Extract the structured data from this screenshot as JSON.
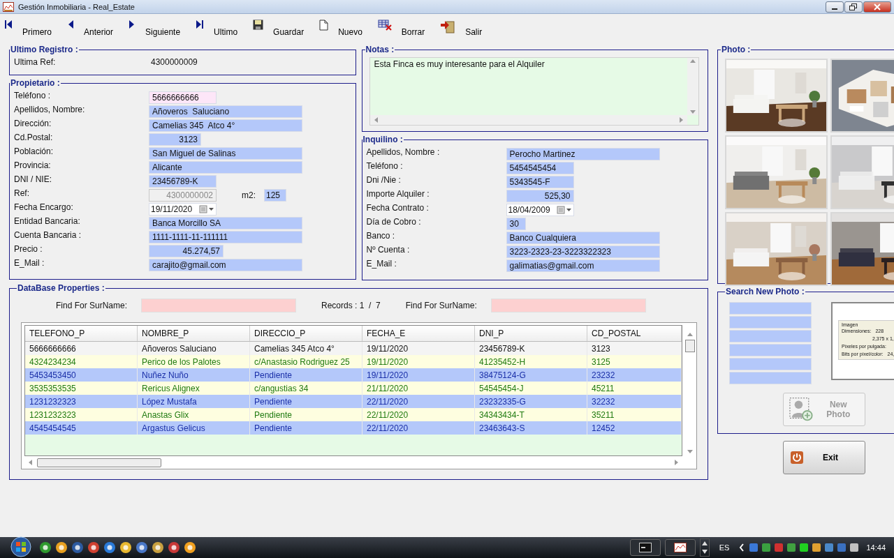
{
  "window": {
    "title": "Gestión Inmobiliaria - Real_Estate"
  },
  "toolbar": [
    {
      "label": "Primero",
      "kind": "first"
    },
    {
      "label": "Anterior",
      "kind": "prev"
    },
    {
      "label": "Siguiente",
      "kind": "next"
    },
    {
      "label": "Ultimo",
      "kind": "last"
    },
    {
      "label": "Guardar",
      "kind": "save"
    },
    {
      "label": "Nuevo",
      "kind": "new"
    },
    {
      "label": "Borrar",
      "kind": "delete"
    },
    {
      "label": "Salir",
      "kind": "exit"
    }
  ],
  "last_record": {
    "title": "Ultimo Registro :",
    "label": "Ultima Ref:",
    "value": "4300000009"
  },
  "owner": {
    "title": "Propietario :",
    "fields": [
      {
        "label": "Teléfono :",
        "value": "5666666666",
        "kind": "key"
      },
      {
        "label": "Apellidos, Nombre:",
        "value": "Añoveros  Saluciano",
        "kind": "text"
      },
      {
        "label": "Dirección:",
        "value": "Camelias 345  Atco 4°",
        "kind": "text"
      },
      {
        "label": "Cd.Postal:",
        "value": "3123",
        "kind": "number"
      },
      {
        "label": "Población:",
        "value": "San Miguel de Salinas",
        "kind": "text"
      },
      {
        "label": "Provincia:",
        "value": "Alicante",
        "kind": "text"
      },
      {
        "label": "DNI / NIE:",
        "value": "23456789-K",
        "kind": "text"
      },
      {
        "label": "Ref:",
        "value": "4300000002",
        "kind": "disabled",
        "extra": {
          "label": "m2:",
          "value": "125"
        }
      },
      {
        "label": "Fecha Encargo:",
        "value": "19/11/2020",
        "kind": "date"
      },
      {
        "label": "Entidad Bancaria:",
        "value": "Banca Morcillo SA",
        "kind": "text"
      },
      {
        "label": "Cuenta Bancaria :",
        "value": "1111-1111-11-111111",
        "kind": "text"
      },
      {
        "label": "Precio :",
        "value": "45.274,57",
        "kind": "number"
      },
      {
        "label": "E_Mail :",
        "value": "carajito@gmail.com",
        "kind": "text"
      }
    ]
  },
  "notes": {
    "title": "Notas :",
    "text": "Esta Finca es muy interesante para el Alquiler"
  },
  "tenant": {
    "title": "Inquilino :",
    "fields": [
      {
        "label": "Apellidos, Nombre :",
        "value": "Perocho Martinez",
        "kind": "text"
      },
      {
        "label": "Teléfono :",
        "value": "5454545454",
        "kind": "text"
      },
      {
        "label": "Dni /Nie :",
        "value": "5343545-F",
        "kind": "text"
      },
      {
        "label": "Importe Alquiler :",
        "value": "525,30",
        "kind": "number"
      },
      {
        "label": "Fecha Contrato :",
        "value": "18/04/2009",
        "kind": "date"
      },
      {
        "label": "Día de Cobro :",
        "value": "30",
        "kind": "text"
      },
      {
        "label": "Banco :",
        "value": "Banco Cualquiera",
        "kind": "text"
      },
      {
        "label": "Nº Cuenta :",
        "value": "3223-2323-23-3223322323",
        "kind": "text"
      },
      {
        "label": "E_Mail :",
        "value": "galimatias@gmail.com",
        "kind": "text"
      }
    ]
  },
  "photo": {
    "title": "Photo :"
  },
  "search_photo": {
    "title": "Search New Photo :",
    "inputs": [
      {
        "kind": "text"
      },
      {
        "kind": "text"
      },
      {
        "kind": "text"
      },
      {
        "kind": "text"
      },
      {
        "kind": "text"
      },
      {
        "kind": "text"
      }
    ],
    "preview": {
      "group": "Imagen",
      "rows": [
        {
          "label": "Dimensiones:",
          "value": "228"
        },
        {
          "value": "2,375 x 1,"
        },
        {
          "label": "Píxeles por pulgada:"
        },
        {
          "label": "Bits por píxel/color:",
          "value": "24,"
        }
      ]
    },
    "new_photo_button": {
      "label": "New Photo",
      "disabled": true
    }
  },
  "exit_button": {
    "label": "Exit"
  },
  "database": {
    "title": "DataBase Properties :",
    "search": [
      {
        "label": "Find For SurName:"
      },
      {
        "label": "Find For SurName:"
      }
    ],
    "records": "Records : 1  /  7",
    "table": {
      "columns": [
        "TELEFONO_P",
        "NOMBRE_P",
        "DIRECCIO_P",
        "FECHA_E",
        "DNI_P",
        "CD_POSTAL"
      ],
      "rows": [
        {
          "selected": true,
          "cells": [
            "5666666666",
            "Añoveros  Saluciano",
            "Camelias 345  Atco 4°",
            "19/11/2020",
            "23456789-K",
            "3123"
          ]
        },
        {
          "selected": false,
          "cells": [
            "4324234234",
            "Perico de los Palotes",
            "c/Anastasio Rodriguez 25",
            "19/11/2020",
            "41235452-H",
            "3125"
          ]
        },
        {
          "selected": false,
          "cells": [
            "5453453450",
            "Nuñez  Nuño",
            "Pendiente",
            "19/11/2020",
            "38475124-G",
            "23232"
          ]
        },
        {
          "selected": false,
          "cells": [
            "3535353535",
            "Rericus Alignex",
            "c/angustias 34",
            "21/11/2020",
            "54545454-J",
            "45211"
          ]
        },
        {
          "selected": false,
          "cells": [
            "1231232323",
            "López Mustafa",
            "Pendiente",
            "22/11/2020",
            "23232335-G",
            "32232"
          ]
        },
        {
          "selected": false,
          "cells": [
            "1231232323",
            "Anastas Glix",
            "Pendiente",
            "22/11/2020",
            "34343434-T",
            "35211"
          ]
        },
        {
          "selected": false,
          "cells": [
            "4545454545",
            "Argastus  Gelicus",
            "Pendiente",
            "22/11/2020",
            "23463643-S",
            "12452"
          ]
        }
      ]
    }
  },
  "taskbar": {
    "language": "ES",
    "clock": "14:44"
  }
}
